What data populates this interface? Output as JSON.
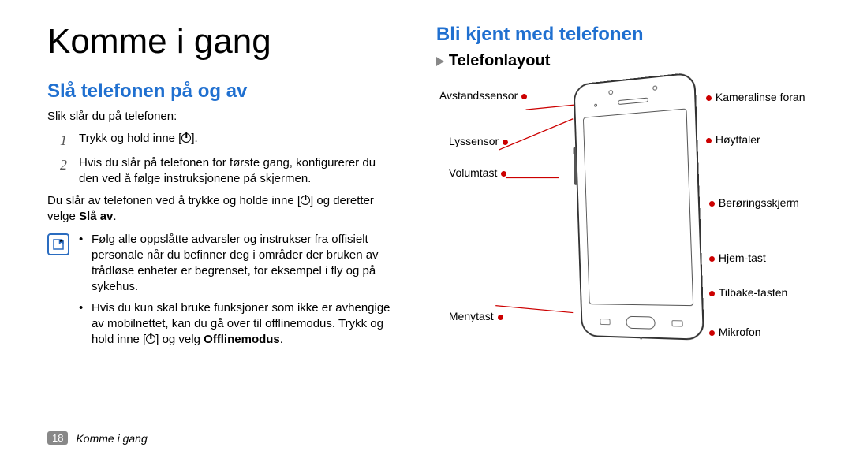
{
  "page_title": "Komme i gang",
  "section1": {
    "heading": "Slå telefonen på og av",
    "intro": "Slik slår du på telefonen:",
    "step1_part1": "Trykk og hold inne [",
    "step1_part2": "].",
    "step2": "Hvis du slår på telefonen for første gang, konfigurerer du den ved å følge instruksjonene på skjermen.",
    "off_part1": "Du slår av telefonen ved å trykke og holde inne [",
    "off_part2": "] og deretter velge ",
    "off_bold": "Slå av",
    "off_part3": ".",
    "note1": "Følg alle oppslåtte advarsler og instrukser fra offisielt personale når du befinner deg i områder der bruken av trådløse enheter er begrenset, for eksempel i fly og på sykehus.",
    "note2_part1": "Hvis du kun skal bruke funksjoner som ikke er avhengige av mobilnettet, kan du gå over til offlinemodus. Trykk og hold inne [",
    "note2_part2": "] og velg ",
    "note2_bold": "Offlinemodus",
    "note2_part3": "."
  },
  "section2": {
    "heading": "Bli kjent med telefonen",
    "subheading": "Telefonlayout",
    "labels": {
      "proximity": "Avstandssensor",
      "light": "Lyssensor",
      "volume": "Volumtast",
      "menu": "Menytast",
      "camera": "Kameralinse foran",
      "speaker": "Høyttaler",
      "touch": "Berøringsskjerm",
      "home": "Hjem-tast",
      "back": "Tilbake-tasten",
      "mic": "Mikrofon"
    }
  },
  "footer": {
    "page_number": "18",
    "chapter": "Komme i gang"
  }
}
